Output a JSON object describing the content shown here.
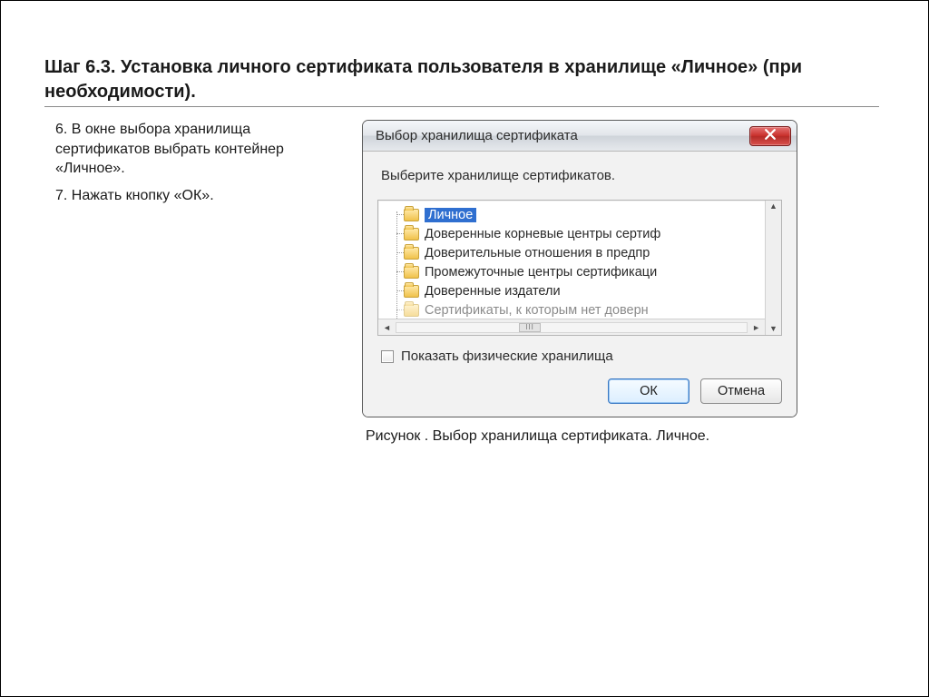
{
  "heading": "Шаг 6.3. Установка личного сертификата пользователя в хранилище «Личное» (при необходимости).",
  "instructions": {
    "step6": "6. В окне выбора хранилища сертификатов выбрать контейнер «Личное».",
    "step7": "7. Нажать кнопку «ОК»."
  },
  "dialog": {
    "title": "Выбор хранилища сертификата",
    "prompt": "Выберите хранилище сертификатов.",
    "tree": [
      {
        "label": "Личное",
        "selected": true
      },
      {
        "label": "Доверенные корневые центры сертиф",
        "selected": false
      },
      {
        "label": "Доверительные отношения в предпр",
        "selected": false
      },
      {
        "label": "Промежуточные центры сертификаци",
        "selected": false
      },
      {
        "label": "Доверенные издатели",
        "selected": false
      },
      {
        "label": "Сертификаты, к которым нет доверн",
        "selected": false
      }
    ],
    "checkbox_label": "Показать физические хранилища",
    "ok": "ОК",
    "cancel": "Отмена"
  },
  "caption": "Рисунок . Выбор хранилища сертификата. Личное."
}
